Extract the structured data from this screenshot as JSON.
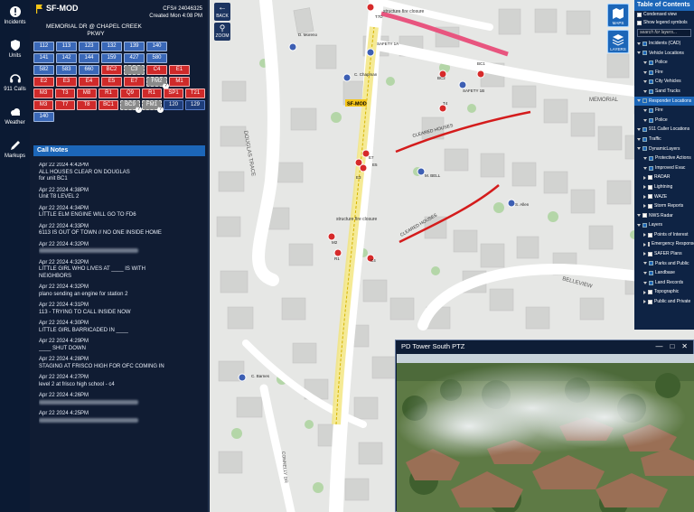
{
  "nav": [
    {
      "icon": "alert-icon",
      "label": "Incidents"
    },
    {
      "icon": "shield-icon",
      "label": "Units"
    },
    {
      "icon": "headset-icon",
      "label": "911 Calls"
    },
    {
      "icon": "cloud-icon",
      "label": "Weather"
    },
    {
      "icon": "pencil-icon",
      "label": "Markups"
    }
  ],
  "incident": {
    "title": "SF-MOD",
    "cfs": "CFS# 24046325",
    "created": "Created Mon 4:08 PM",
    "address_line1": "MEMORIAL DR @ CHAPEL CREEK",
    "address_line2": "PKWY"
  },
  "units": [
    [
      {
        "t": "112",
        "c": "blue"
      },
      {
        "t": "113",
        "c": "blue"
      },
      {
        "t": "123",
        "c": "blue"
      },
      {
        "t": "132",
        "c": "blue"
      },
      {
        "t": "139",
        "c": "blue"
      },
      {
        "t": "140",
        "c": "blue"
      }
    ],
    [
      {
        "t": "141",
        "c": "blue"
      },
      {
        "t": "142",
        "c": "blue"
      },
      {
        "t": "144",
        "c": "blue"
      },
      {
        "t": "159",
        "c": "blue"
      },
      {
        "t": "427",
        "c": "blue"
      },
      {
        "t": "580",
        "c": "blue"
      }
    ],
    [
      {
        "t": "582",
        "c": "blue"
      },
      {
        "t": "583",
        "c": "blue"
      },
      {
        "t": "660",
        "c": "blue"
      },
      {
        "t": "BC2",
        "c": "red"
      },
      {
        "t": "C3",
        "c": "gray"
      },
      {
        "t": "C4",
        "c": "red"
      },
      {
        "t": "E1",
        "c": "red"
      }
    ],
    [
      {
        "t": "E2",
        "c": "red"
      },
      {
        "t": "E3",
        "c": "red"
      },
      {
        "t": "E4",
        "c": "red"
      },
      {
        "t": "E5",
        "c": "red"
      },
      {
        "t": "E7",
        "c": "red"
      },
      {
        "t": "FM2",
        "c": "gray"
      },
      {
        "t": "M1",
        "c": "red"
      }
    ],
    [
      {
        "t": "M3",
        "c": "red"
      },
      {
        "t": "T3",
        "c": "red"
      },
      {
        "t": "M8",
        "c": "red"
      },
      {
        "t": "R1",
        "c": "red"
      },
      {
        "t": "Q9",
        "c": "red"
      },
      {
        "t": "R1",
        "c": "red"
      },
      {
        "t": "SP1",
        "c": "red"
      },
      {
        "t": "T21",
        "c": "red"
      }
    ],
    [
      {
        "t": "M3",
        "c": "red"
      },
      {
        "t": "T7",
        "c": "red"
      },
      {
        "t": "T8",
        "c": "red"
      },
      {
        "t": "BC1",
        "c": "red"
      },
      {
        "t": "BC9",
        "c": "gray"
      },
      {
        "t": "FM1",
        "c": "gray"
      },
      {
        "t": "120",
        "c": "dark"
      },
      {
        "t": "129",
        "c": "dark"
      }
    ],
    [
      {
        "t": "140",
        "c": "blue"
      }
    ]
  ],
  "call_notes": {
    "header": "Call Notes",
    "entries": [
      {
        "time": "Apr 22 2024  4:42PM",
        "lines": [
          "ALL HOUSES CLEAR ON DOUGLAS",
          "for unit BC1"
        ]
      },
      {
        "time": "Apr 22 2024  4:38PM",
        "lines": [
          "Unit T8 LEVEL 2"
        ]
      },
      {
        "time": "Apr 22 2024  4:34PM",
        "lines": [
          "LITTLE ELM ENGINE WILL GO TO FD6"
        ]
      },
      {
        "time": "Apr 22 2024  4:33PM",
        "lines": [
          "6113 IS OUT OF TOWN // NO ONE INSIDE HOME"
        ]
      },
      {
        "time": "Apr 22 2024  4:32PM",
        "lines": [
          ""
        ]
      },
      {
        "time": "Apr 22 2024  4:32PM",
        "lines": [
          "LITTLE GIRL WHO LIVES AT ____ IS WITH",
          "NEIGHBORS"
        ]
      },
      {
        "time": "Apr 22 2024  4:32PM",
        "lines": [
          "plano sending an engine for station 2"
        ]
      },
      {
        "time": "Apr 22 2024  4:31PM",
        "lines": [
          "113 - TRYING TO CALL INSIDE NOW"
        ]
      },
      {
        "time": "Apr 22 2024  4:30PM",
        "lines": [
          "LITTLE GIRL BARRICADED IN ____"
        ]
      },
      {
        "time": "Apr 22 2024  4:29PM",
        "lines": [
          "____ SHUT DOWN"
        ]
      },
      {
        "time": "Apr 22 2024  4:28PM",
        "lines": [
          "STAGING AT FRISCO HIGH FOR OFC COMING IN"
        ]
      },
      {
        "time": "Apr 22 2024  4:27PM",
        "lines": [
          "level 2 at frisco high school - c4"
        ]
      },
      {
        "time": "Apr 22 2024  4:26PM",
        "lines": [
          ""
        ]
      },
      {
        "time": "Apr 22 2024  4:25PM",
        "lines": [
          ""
        ]
      }
    ]
  },
  "map_tools": [
    {
      "icon": "back-icon",
      "label": "BACK"
    },
    {
      "icon": "zoom-icon",
      "label": "ZOOM"
    }
  ],
  "map_buttons": [
    {
      "icon": "map-icon",
      "label": "MAPS"
    },
    {
      "icon": "layers-icon",
      "label": "LAYERS"
    }
  ],
  "map_labels": {
    "road_douglas": "DOUGLAS TRACE",
    "road_memorial": "MEMORIAL",
    "road_belleview": "BELLEVIEW",
    "cleared1": "CLEARED HOUSES",
    "cleared2": "CLEARED HOUSES",
    "closure1": "structure fire closure",
    "closure2": "structure fire closure",
    "sfmod": "SF-MOD",
    "units": [
      "SAFETY 1A",
      "SAFETY 1B",
      "BC2",
      "BC1",
      "E5",
      "E3",
      "E7",
      "M2",
      "R1",
      "C4",
      "T4",
      "T7D",
      "S. Allen",
      "M. BELL",
      "C. Barnes",
      "C. Chapman",
      "D. Moreno"
    ],
    "road_connely": "CONNELLY DR"
  },
  "toc": {
    "header": "Table of Contents",
    "condensed": "Condensed view",
    "legend": "Show legend symbols",
    "search_placeholder": "search for layers...",
    "layers": [
      {
        "label": "Incidents (CAD)",
        "lvl": 1,
        "chk": true
      },
      {
        "label": "Vehicle Locations",
        "lvl": 1,
        "chk": true
      },
      {
        "label": "Police",
        "lvl": 2,
        "chk": true
      },
      {
        "label": "Fire",
        "lvl": 2,
        "chk": true
      },
      {
        "label": "City Vehicles",
        "lvl": 2,
        "chk": true
      },
      {
        "label": "Sand Trucks",
        "lvl": 2,
        "chk": true
      },
      {
        "label": "Responder Locations",
        "lvl": 1,
        "chk": true,
        "hl": true
      },
      {
        "label": "Fire",
        "lvl": 2,
        "chk": true
      },
      {
        "label": "Police",
        "lvl": 2,
        "chk": true
      },
      {
        "label": "911 Caller Locations",
        "lvl": 1,
        "chk": true
      },
      {
        "label": "Traffic",
        "lvl": 1,
        "chk": true
      },
      {
        "label": "DynamicLayers",
        "lvl": 1,
        "chk": true
      },
      {
        "label": "Protective Actions",
        "lvl": 2,
        "chk": true
      },
      {
        "label": "Improved Evac",
        "lvl": 2,
        "chk": true
      },
      {
        "label": "RADAR",
        "lvl": 2,
        "chk": false
      },
      {
        "label": "Lightning",
        "lvl": 2,
        "chk": false
      },
      {
        "label": "WAZE",
        "lvl": 2,
        "chk": false
      },
      {
        "label": "Storm Reports",
        "lvl": 2,
        "chk": false
      },
      {
        "label": "NWS Radar",
        "lvl": 1,
        "chk": false
      },
      {
        "label": "Layers",
        "lvl": 1,
        "chk": true
      },
      {
        "label": "Points of Interest",
        "lvl": 2,
        "chk": false
      },
      {
        "label": "Emergency Response",
        "lvl": 2,
        "chk": false
      },
      {
        "label": "SAFER Plans",
        "lvl": 2,
        "chk": false
      },
      {
        "label": "Parks and Public",
        "lvl": 2,
        "chk": true
      },
      {
        "label": "Landbase",
        "lvl": 2,
        "chk": true
      },
      {
        "label": "Land Records",
        "lvl": 2,
        "chk": true
      },
      {
        "label": "Topographic",
        "lvl": 2,
        "chk": false
      },
      {
        "label": "Public and Private",
        "lvl": 2,
        "chk": false
      }
    ]
  },
  "video": {
    "title": "PD Tower South PTZ",
    "min": "—",
    "max": "□",
    "close": "✕"
  },
  "colors": {
    "accent": "#1c66b8",
    "unit_blue": "#3a68b8",
    "unit_red": "#cf2a2a",
    "panel": "#101c33",
    "map_bg": "#e6e7e5"
  }
}
